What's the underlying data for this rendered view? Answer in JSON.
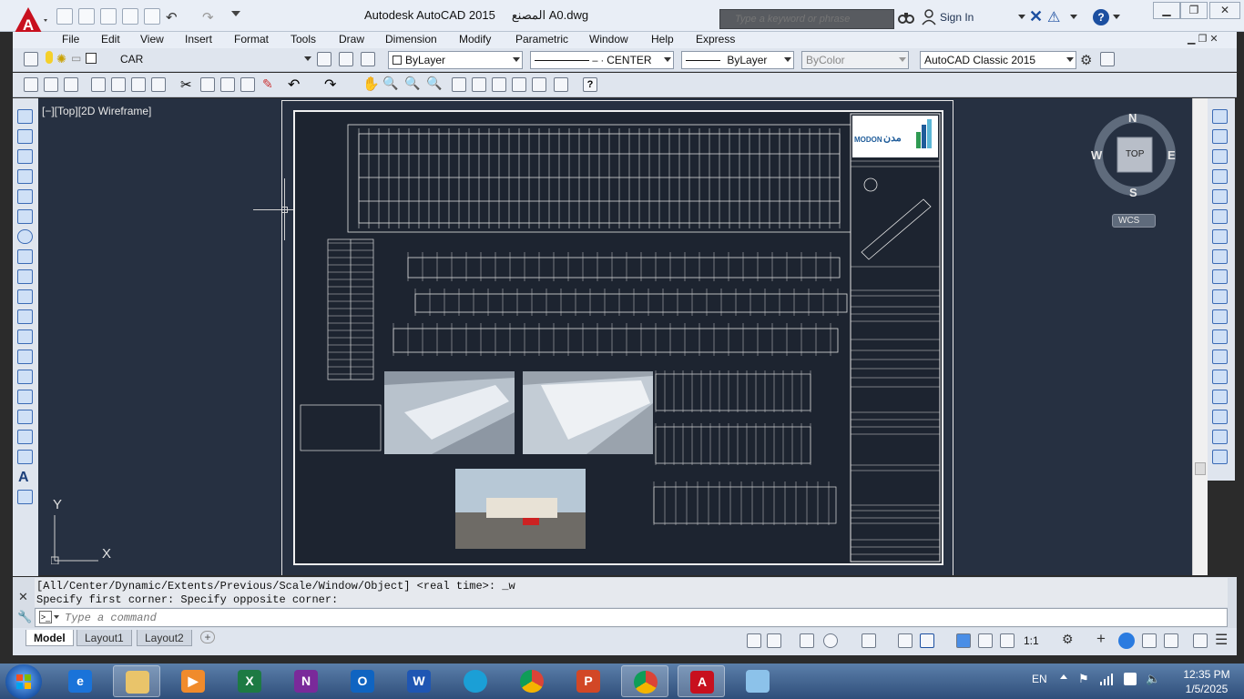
{
  "titlebar": {
    "title": "Autodesk AutoCAD 2015",
    "filename": "المصنع A0.dwg",
    "search_placeholder": "Type a keyword or phrase",
    "sign_in": "Sign In",
    "help": "?"
  },
  "menu": [
    "File",
    "Edit",
    "View",
    "Insert",
    "Format",
    "Tools",
    "Draw",
    "Dimension",
    "Modify",
    "Parametric",
    "Window",
    "Help",
    "Express"
  ],
  "toolbar": {
    "layer": "CAR",
    "color": "ByLayer",
    "linetype": "CENTER",
    "lineweight": "ByLayer",
    "plotstyle": "ByColor",
    "workspace": "AutoCAD Classic 2015"
  },
  "viewport": {
    "label": "[−][Top][2D Wireframe]"
  },
  "viewcube": {
    "north": "N",
    "south": "S",
    "east": "E",
    "west": "W",
    "top": "TOP",
    "wcs": "WCS"
  },
  "ucs": {
    "x": "X",
    "y": "Y"
  },
  "drawing": {
    "brand": "MODON",
    "brand_arabic": "مدن"
  },
  "commandline": {
    "history": [
      "[All/Center/Dynamic/Extents/Previous/Scale/Window/Object] <real time>: _w",
      "Specify first corner: Specify opposite corner:"
    ],
    "placeholder": "Type a command"
  },
  "layout_tabs": [
    "Model",
    "Layout1",
    "Layout2"
  ],
  "status": {
    "scale": "1:1"
  },
  "taskbar": {
    "language": "EN",
    "time": "12:35 PM",
    "date": "1/5/2025"
  }
}
